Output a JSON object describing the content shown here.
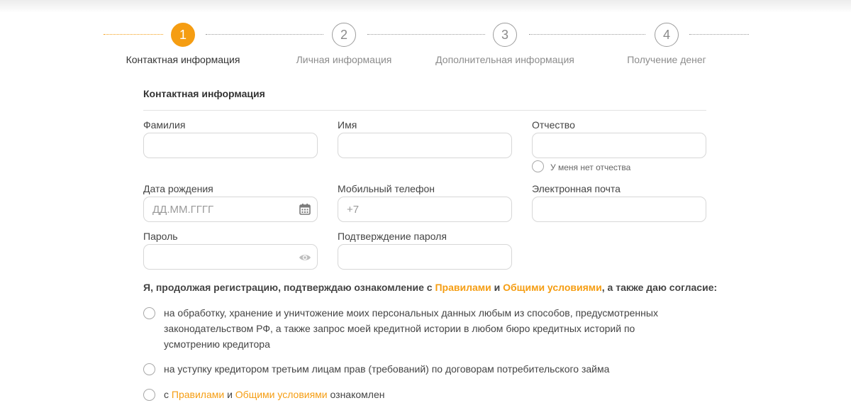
{
  "steps": [
    {
      "number": "1",
      "label": "Контактная информация",
      "active": true
    },
    {
      "number": "2",
      "label": "Личная информация",
      "active": false
    },
    {
      "number": "3",
      "label": "Дополнительная информация",
      "active": false
    },
    {
      "number": "4",
      "label": "Получение денег",
      "active": false
    }
  ],
  "form": {
    "section_title": "Контактная информация",
    "last_name_label": "Фамилия",
    "first_name_label": "Имя",
    "patronymic_label": "Отчество",
    "no_patronymic_label": "У меня нет отчества",
    "birth_date_label": "Дата рождения",
    "birth_date_placeholder": "ДД.ММ.ГГГГ",
    "phone_label": "Мобильный телефон",
    "phone_placeholder": "+7",
    "email_label": "Электронная почта",
    "password_label": "Пароль",
    "password_confirm_label": "Подтверждение пароля"
  },
  "consent": {
    "lead_prefix": "Я, продолжая регистрацию, подтверждаю ознакомление с ",
    "rules_link": "Правилами",
    "and": " и ",
    "terms_link": "Общими условиями",
    "lead_suffix": ", а также даю согласие:",
    "item1_line1": "на обработку, хранение и уничтожение моих персональных данных любым из способов, предусмотренных",
    "item1_line2": "законодательством РФ, а также запрос моей кредитной истории в любом бюро кредитных историй по",
    "item1_line3": "усмотрению кредитора",
    "item2": "на уступку кредитором третьим лицам прав (требований) по договорам потребительского займа",
    "item3_prefix": "с ",
    "item3_rules": "Правилами",
    "item3_and": " и ",
    "item3_terms": "Общими условиями",
    "item3_suffix": " ознакомлен"
  },
  "colors": {
    "accent": "#f59d12",
    "border": "#d7d7d7",
    "muted": "#8c8c8c"
  },
  "icons": {
    "birth_date": "calendar-icon",
    "password": "eye-icon"
  }
}
